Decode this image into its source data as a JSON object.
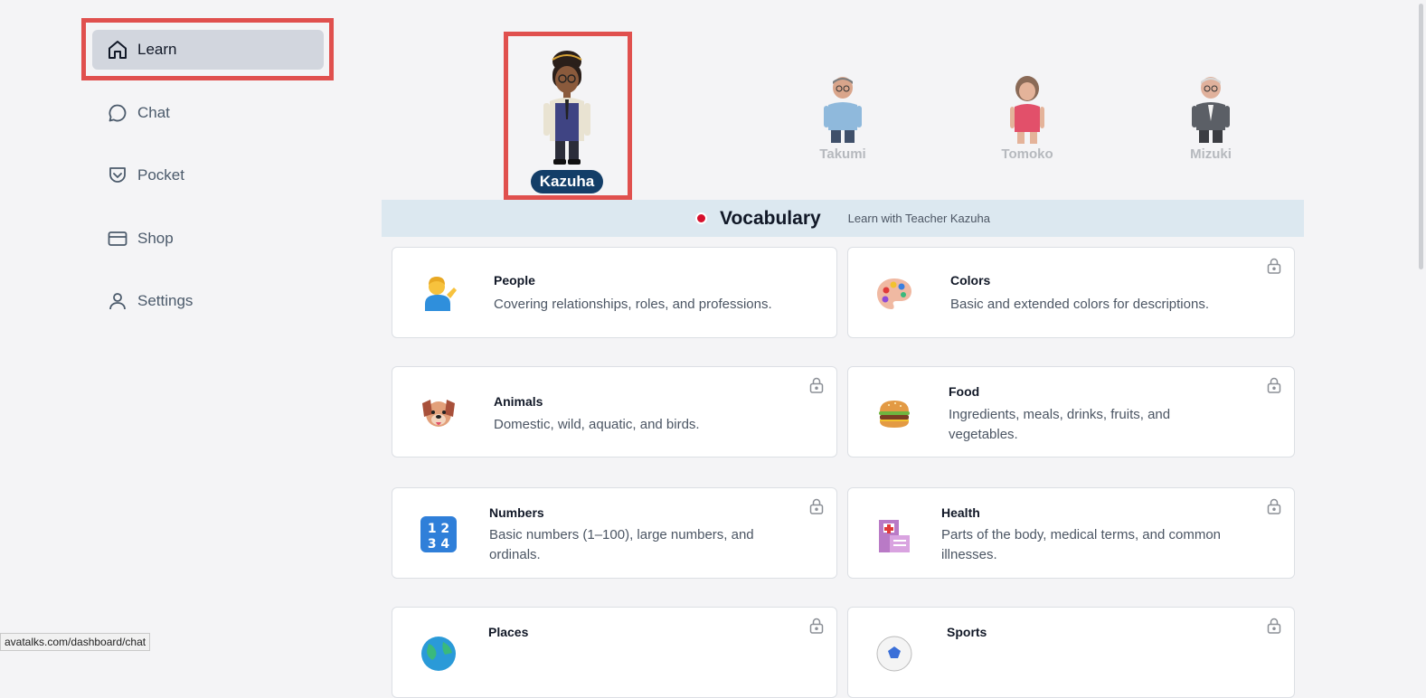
{
  "sidebar": {
    "items": [
      {
        "label": "Learn",
        "icon": "home-icon",
        "active": true
      },
      {
        "label": "Chat",
        "icon": "chat-icon",
        "active": false
      },
      {
        "label": "Pocket",
        "icon": "pocket-icon",
        "active": false
      },
      {
        "label": "Shop",
        "icon": "card-icon",
        "active": false
      },
      {
        "label": "Settings",
        "icon": "user-icon",
        "active": false
      }
    ]
  },
  "teachers": [
    {
      "name": "Kazuha",
      "selected": true
    },
    {
      "name": "Takumi",
      "selected": false
    },
    {
      "name": "Tomoko",
      "selected": false
    },
    {
      "name": "Mizuki",
      "selected": false
    }
  ],
  "section": {
    "title": "Vocabulary",
    "subtitle": "Learn with Teacher Kazuha",
    "flag_color": "#d7102c"
  },
  "cards": [
    {
      "title": "People",
      "desc": "Covering relationships, roles, and professions.",
      "icon": "person-tipping-hand-icon",
      "locked": false
    },
    {
      "title": "Colors",
      "desc": "Basic and extended colors for descriptions.",
      "icon": "palette-icon",
      "locked": true
    },
    {
      "title": "Animals",
      "desc": "Domestic, wild, aquatic, and birds.",
      "icon": "dog-face-icon",
      "locked": true
    },
    {
      "title": "Food",
      "desc": "Ingredients, meals, drinks, fruits, and vegetables.",
      "icon": "hamburger-icon",
      "locked": true
    },
    {
      "title": "Numbers",
      "desc": "Basic numbers (1–100), large numbers, and ordinals.",
      "icon": "numbers-1234-icon",
      "locked": true
    },
    {
      "title": "Health",
      "desc": "Parts of the body, medical terms, and common illnesses.",
      "icon": "hospital-icon",
      "locked": true
    },
    {
      "title": "Places",
      "desc": "",
      "icon": "globe-icon",
      "locked": true
    },
    {
      "title": "Sports",
      "desc": "",
      "icon": "soccer-ball-icon",
      "locked": true
    }
  ],
  "status_bar": {
    "url": "avatalks.com/dashboard/chat"
  },
  "colors": {
    "accent_highlight": "#e0504e",
    "selected_name_bg": "#133e68"
  }
}
